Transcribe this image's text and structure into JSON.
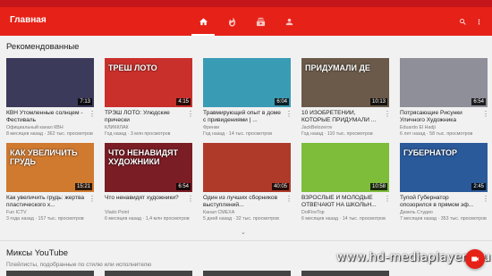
{
  "appbar": {
    "title": "Главная",
    "tabs": [
      {
        "name": "home",
        "icon": "home-icon",
        "active": true
      },
      {
        "name": "trending",
        "icon": "fire-icon",
        "active": false
      },
      {
        "name": "subscriptions",
        "icon": "subscriptions-icon",
        "active": false
      },
      {
        "name": "account",
        "icon": "account-icon",
        "active": false
      }
    ],
    "actions": [
      "search-icon",
      "more-vert-icon"
    ],
    "color": "#e62117"
  },
  "recommended": {
    "title": "Рекомендованные",
    "videos": [
      {
        "title": "КВН Утомленные солнцем - Фестиваль",
        "channel": "Официальный канал КВН",
        "meta": "8 месяцев назад · 362 тыс. просмотров",
        "duration": "7:13",
        "overlay": "",
        "bg": "#3b3a5a"
      },
      {
        "title": "ТРЭШ ЛОТО: Улюдские прически",
        "channel": "КЛИККЛАК",
        "meta": "Год назад · 3 млн просмотров",
        "duration": "4:15",
        "overlay": "ТРЕШ ЛОТО",
        "bg": "#c9302c"
      },
      {
        "title": "Травмирующий опыт в доме с привидениями | ...",
        "channel": "Френки",
        "meta": "Год назад · 14 тыс. просмотров",
        "duration": "6:04",
        "overlay": "",
        "bg": "#3a9bb5"
      },
      {
        "title": "10 ИЗОБРЕТЕНИЙ, КОТОРЫЕ ПРИДУМАЛИ ...",
        "channel": "JackBelozerov",
        "meta": "Год назад · 110 тыс. просмотров",
        "duration": "10:13",
        "overlay": "ПРИДУМАЛИ ДЕ",
        "bg": "#6b5a4a"
      },
      {
        "title": "Потрясающие Рисунки Уличного Художника",
        "channel": "Eduardo El Hadji",
        "meta": "6 лет назад · 58 тыс. просмотров",
        "duration": "6:54",
        "overlay": "",
        "bg": "#8f8f9a"
      }
    ],
    "videos2": [
      {
        "title": "Как увеличить грудь: жертва пластического х...",
        "channel": "Fun ICTV",
        "meta": "3 года назад · 157 тыс. просмотров",
        "duration": "15:21",
        "overlay": "КАК УВЕЛИЧИТЬ ГРУДЬ",
        "bg": "#d07a30"
      },
      {
        "title": "Что ненавидят художники?",
        "channel": "Vlado Point",
        "meta": "6 месяцев назад · 1,4 млн просмотров",
        "duration": "6:54",
        "overlay": "ЧТО НЕНАВИДЯТ ХУДОЖНИКИ",
        "bg": "#7a1d25"
      },
      {
        "title": "Один из лучших сборников выступлений...",
        "channel": "Канал СМЕХА",
        "meta": "5 дней назад · 32 тыс. просмотров",
        "duration": "40:05",
        "overlay": "",
        "bg": "#b03a2a"
      },
      {
        "title": "ВЗРОСЛЫЕ И МОЛОДЫЕ ОТВЕЧАЮТ НА ШКОЛЬН...",
        "channel": "DolFireTop",
        "meta": "6 месяцев назад · 14 тыс. просмотров",
        "duration": "10:58",
        "overlay": "",
        "bg": "#7dbd3a"
      },
      {
        "title": "Тупой Губернатор опозорился в прямом эф...",
        "channel": "Дизель Студио",
        "meta": "7 месяцев назад · 353 тыс. просмотров",
        "duration": "2:45",
        "overlay": "ГУБЕРНАТОР",
        "bg": "#2a5a9a"
      }
    ]
  },
  "mixes": {
    "title": "Миксы YouTube",
    "subtitle": "Плейлисты, подобранные по стилю или исполнителю"
  },
  "watermark": "www.hd-mediaplayers.ru"
}
